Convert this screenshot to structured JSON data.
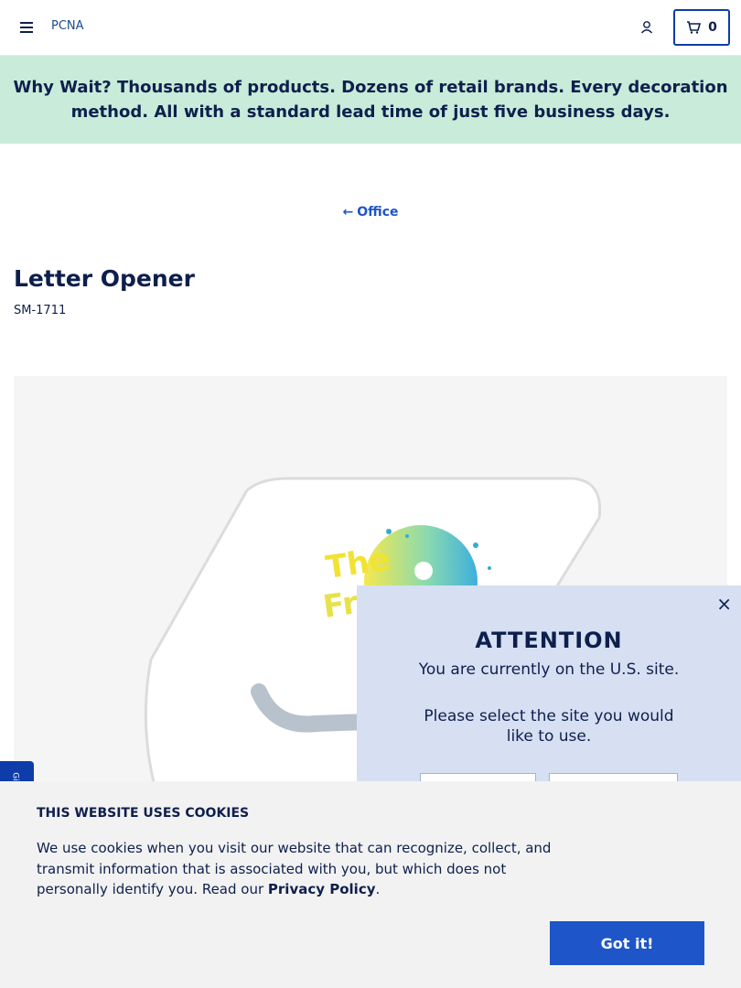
{
  "header": {
    "logo_alt": "PCNA",
    "cart_count": "0"
  },
  "banner": {
    "lead": "Why Wait?",
    "text": " Thousands of products. Dozens of retail brands. Every decoration method. All with a standard lead time of just five business days."
  },
  "breadcrumb": {
    "back_label": "Office"
  },
  "product": {
    "title": "Letter Opener",
    "sku": "SM-1711"
  },
  "side_tab": {
    "label": "Gi"
  },
  "site_modal": {
    "title": "ATTENTION",
    "line1": "You are currently on the U.S. site.",
    "line2": "Please select the site you would like to use."
  },
  "cookie_banner": {
    "title": "THIS WEBSITE USES COOKIES",
    "text_before": "We use cookies when you visit our website that can recognize, collect, and transmit information that is associated with you, but which does not personally identify you. Read our ",
    "link": "Privacy Policy",
    "text_after": ".",
    "button": "Got it!"
  },
  "colors": {
    "navy": "#0e1f4d",
    "brand_blue": "#1e55c8",
    "banner_green": "#c8ecd9",
    "modal_bg": "#d6e0f2"
  }
}
